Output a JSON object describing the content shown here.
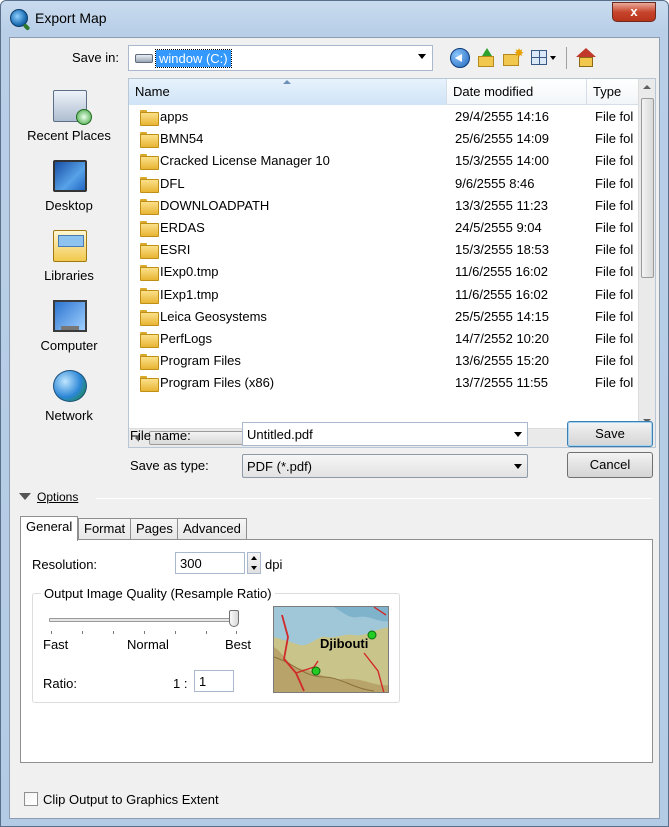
{
  "window": {
    "title": "Export Map",
    "close_glyph": "x"
  },
  "toolbar": {
    "save_in_label": "Save in:",
    "save_in_value": "window (C:)",
    "icons": [
      "back-icon",
      "up-folder-icon",
      "new-folder-icon",
      "views-menu-icon",
      "home-icon"
    ]
  },
  "places": [
    {
      "label": "Recent Places",
      "icon": "recent-places-icon"
    },
    {
      "label": "Desktop",
      "icon": "desktop-icon"
    },
    {
      "label": "Libraries",
      "icon": "libraries-icon"
    },
    {
      "label": "Computer",
      "icon": "computer-icon"
    },
    {
      "label": "Network",
      "icon": "network-icon"
    }
  ],
  "file_list": {
    "columns": {
      "name": "Name",
      "date": "Date modified",
      "type": "Type"
    },
    "rows": [
      {
        "name": "apps",
        "date": "29/4/2555 14:16",
        "type": "File fol"
      },
      {
        "name": "BMN54",
        "date": "25/6/2555 14:09",
        "type": "File fol"
      },
      {
        "name": "Cracked License Manager 10",
        "date": "15/3/2555 14:00",
        "type": "File fol"
      },
      {
        "name": "DFL",
        "date": "9/6/2555 8:46",
        "type": "File fol"
      },
      {
        "name": "DOWNLOADPATH",
        "date": "13/3/2555 11:23",
        "type": "File fol"
      },
      {
        "name": "ERDAS",
        "date": "24/5/2555 9:04",
        "type": "File fol"
      },
      {
        "name": "ESRI",
        "date": "15/3/2555 18:53",
        "type": "File fol"
      },
      {
        "name": "IExp0.tmp",
        "date": "11/6/2555 16:02",
        "type": "File fol"
      },
      {
        "name": "IExp1.tmp",
        "date": "11/6/2555 16:02",
        "type": "File fol"
      },
      {
        "name": "Leica Geosystems",
        "date": "25/5/2555 14:15",
        "type": "File fol"
      },
      {
        "name": "PerfLogs",
        "date": "14/7/2552 10:20",
        "type": "File fol"
      },
      {
        "name": "Program Files",
        "date": "13/6/2555 15:20",
        "type": "File fol"
      },
      {
        "name": "Program Files (x86)",
        "date": "13/7/2555 11:55",
        "type": "File fol"
      }
    ],
    "hscroll_grip": "III"
  },
  "file_name": {
    "label": "File name:",
    "value": "Untitled.pdf"
  },
  "save_as_type": {
    "label": "Save as type:",
    "value": "PDF (*.pdf)"
  },
  "buttons": {
    "save": "Save",
    "cancel": "Cancel"
  },
  "options": {
    "label": "Options",
    "tabs": [
      "General",
      "Format",
      "Pages",
      "Advanced"
    ],
    "active_tab": "General",
    "resolution_label": "Resolution:",
    "resolution_value": "300",
    "resolution_unit": "dpi",
    "quality_group_title": "Output Image Quality (Resample Ratio)",
    "slider_labels": {
      "fast": "Fast",
      "normal": "Normal",
      "best": "Best"
    },
    "slider_position": 1.0,
    "ratio_label": "Ratio:",
    "ratio_prefix": "1 :",
    "ratio_value": "1",
    "preview_label": "Djibouti"
  },
  "clip_output": {
    "label": "Clip Output to Graphics Extent",
    "checked": false
  }
}
